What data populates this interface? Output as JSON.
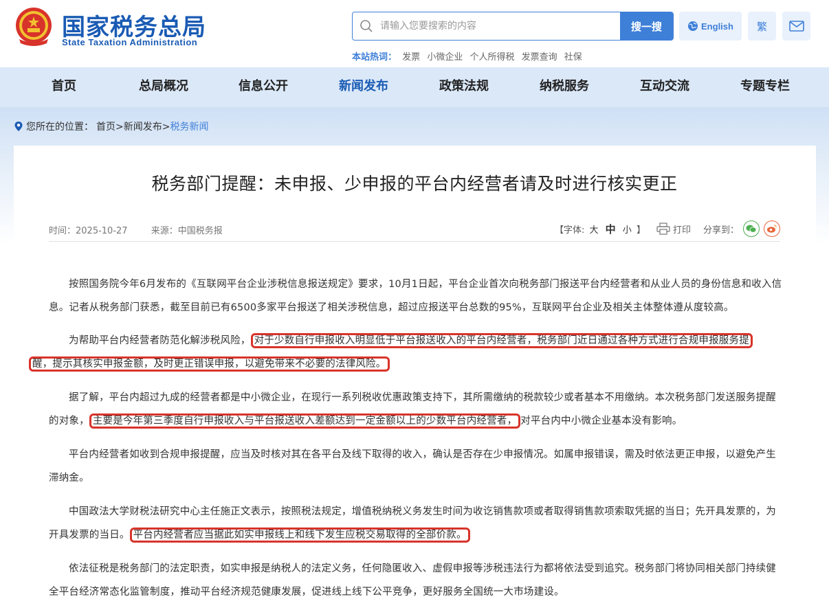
{
  "header": {
    "logo_cn": "国家税务总局",
    "logo_en": "State Taxation Administration",
    "search_placeholder": "请输入您要搜索的内容",
    "search_button": "搜一搜",
    "english_button": "English",
    "traditional_button": "繁",
    "hot_label": "本站热词：",
    "hot_words": [
      "发票",
      "小微企业",
      "个人所得税",
      "发票查询",
      "社保"
    ]
  },
  "nav": {
    "items": [
      "首页",
      "总局概况",
      "信息公开",
      "新闻发布",
      "政策法规",
      "纳税服务",
      "互动交流",
      "专题专栏"
    ],
    "active_index": 3
  },
  "breadcrumb": {
    "prefix": "您所在的位置：",
    "path": "首页>新闻发布>",
    "current": "税务新闻"
  },
  "article": {
    "title": "税务部门提醒：未申报、少申报的平台内经营者请及时进行核实更正",
    "time": "时间：2025-10-27",
    "source": "来源：中国税务报",
    "fontsize_open": "【字体:",
    "fontsize_large": "大",
    "fontsize_medium": "中",
    "fontsize_small": "小",
    "fontsize_close": "】",
    "print_label": "打印",
    "share_label": "分享到：",
    "paragraphs": {
      "p1": "按照国务院今年6月发布的《互联网平台企业涉税信息报送规定》要求，10月1日起，平台企业首次向税务部门报送平台内经营者和从业人员的身份信息和收入信息。记者从税务部门获悉，截至目前已有6500多家平台报送了相关涉税信息，超过应报送平台总数的95%，互联网平台企业及相关主体整体遵从度较高。",
      "p2_a": "为帮助平台内经营者防范化解涉税风险，",
      "p2_hl1": "对于少数自行申报收入明显低于平台报送收入的平台内经营者，税务部门近日通过各种方式进行合规申报服务提",
      "p2_hl2": "醒，提示其核实申报金额，及时更正错误申报，以避免带来不必要的法律风险。",
      "p3_a": "据了解，平台内超过九成的经营者都是中小微企业，在现行一系列税收优惠政策支持下，其所需缴纳的税款较少或者基本不用缴纳。本次税务部门发送服务提醒的对象，",
      "p3_hl": "主要是今年第三季度自行申报收入与平台报送收入差额达到一定金额以上的少数平台内经营者，",
      "p3_b": "对平台内中小微企业基本没有影响。",
      "p4": "平台内经营者如收到合规申报提醒，应当及时核对其在各平台及线下取得的收入，确认是否存在少申报情况。如属申报错误，需及时依法更正申报，以避免产生滞纳金。",
      "p5_a": "中国政法大学财税法研究中心主任施正文表示，按照税法规定，增值税纳税义务发生时间为收讫销售款项或者取得销售款项索取凭据的当日；先开具发票的，为开具发票的当日。",
      "p5_hl": "平台内经营者应当据此如实申报线上和线下发生应税交易取得的全部价款。",
      "p6": "依法征税是税务部门的法定职责，如实申报是纳税人的法定义务，任何隐匿收入、虚假申报等涉税违法行为都将依法受到追究。税务部门将协同相关部门持续健全平台经济常态化监管制度，推动平台经济规范健康发展，促进线上线下公平竞争，更好服务全国统一大市场建设。"
    }
  },
  "colors": {
    "brand_blue": "#1a5bb4",
    "accent_blue": "#3e7fd8",
    "highlight_red": "#d8332a",
    "wechat_green": "#4caf50",
    "weibo_orange": "#e8663a"
  }
}
